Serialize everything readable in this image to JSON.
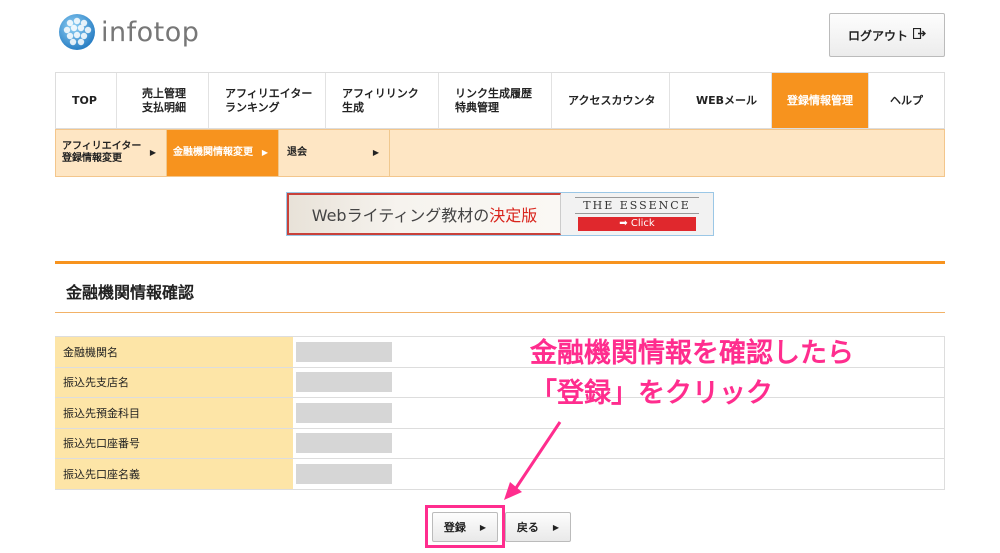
{
  "header": {
    "logo_text": "infotop",
    "logout_label": "ログアウト",
    "logout_icon": "logout-icon"
  },
  "nav": {
    "items": [
      {
        "label": "TOP"
      },
      {
        "label": "売上管理\n支払明細"
      },
      {
        "label": "アフィリエイター\nランキング"
      },
      {
        "label": "アフィリリンク\n生成"
      },
      {
        "label": "リンク生成履歴\n特典管理"
      },
      {
        "label": "アクセスカウンタ"
      },
      {
        "label": "WEBメール"
      },
      {
        "label": "登録情報管理",
        "active": true
      },
      {
        "label": "ヘルプ"
      }
    ]
  },
  "subnav": {
    "items": [
      {
        "label": "アフィリエイター\n登録情報変更"
      },
      {
        "label": "金融機関情報変更",
        "active": true
      },
      {
        "label": "退会"
      }
    ]
  },
  "banner": {
    "left_text_1": "Webライティング教材の",
    "left_text_2": "決定版",
    "right_title": "THE ESSENCE",
    "right_click": "➡ Click"
  },
  "section": {
    "title": "金融機関情報確認"
  },
  "table": {
    "rows": [
      {
        "label": "金融機関名"
      },
      {
        "label": "振込先支店名"
      },
      {
        "label": "振込先預金科目"
      },
      {
        "label": "振込先口座番号"
      },
      {
        "label": "振込先口座名義"
      }
    ]
  },
  "annotation": {
    "text": "金融機関情報を確認したら\n「登録」をクリック",
    "color": "#ff2d8e"
  },
  "buttons": {
    "register_label": "登録",
    "back_label": "戻る"
  },
  "colors": {
    "accent": "#f7931e",
    "subnav_bg": "#fee6c4",
    "label_bg": "#fde5a7",
    "highlight": "#ff2d8e"
  }
}
